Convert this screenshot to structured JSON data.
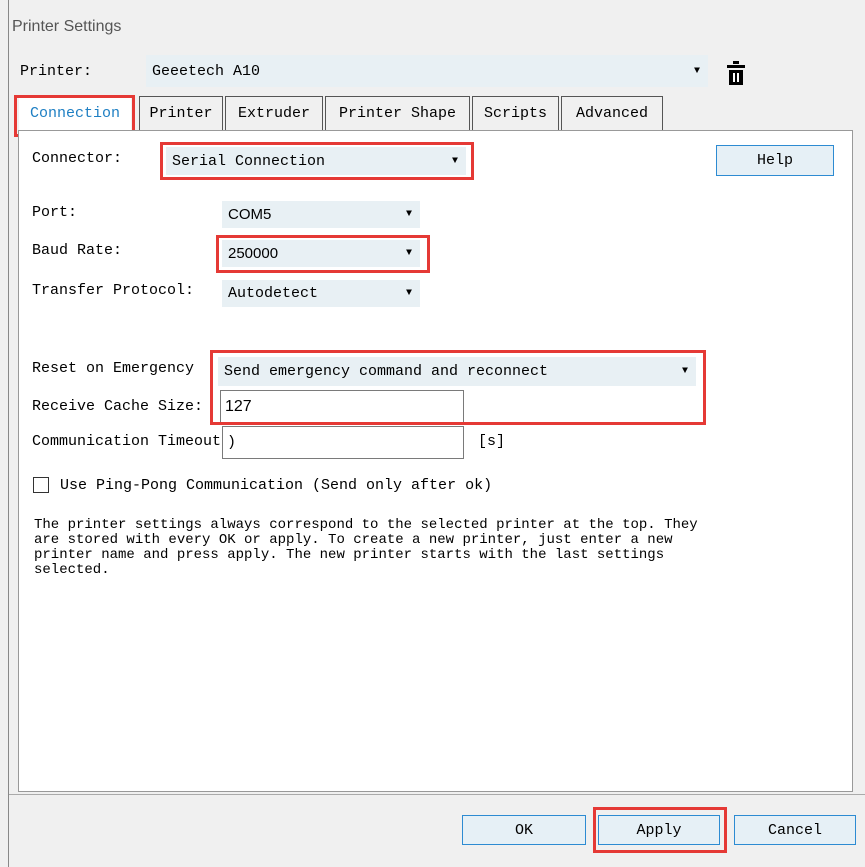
{
  "window": {
    "title": "Printer Settings"
  },
  "printer_row": {
    "label": "Printer:",
    "value": "Geeetech A10"
  },
  "tabs": [
    {
      "label": "Connection"
    },
    {
      "label": "Printer"
    },
    {
      "label": "Extruder"
    },
    {
      "label": "Printer Shape"
    },
    {
      "label": "Scripts"
    },
    {
      "label": "Advanced"
    }
  ],
  "connection": {
    "connector_label": "Connector:",
    "connector_value": "Serial Connection",
    "help_label": "Help",
    "port_label": "Port:",
    "port_value": "COM5",
    "baud_label": "Baud Rate:",
    "baud_value": "250000",
    "protocol_label": "Transfer Protocol:",
    "protocol_value": "Autodetect",
    "reset_label": "Reset on Emergency",
    "reset_value": "Send emergency command and reconnect",
    "cache_label": "Receive Cache Size:",
    "cache_value": "127",
    "timeout_label": "Communication Timeout:",
    "timeout_value": ")",
    "timeout_unit": "[s]",
    "pingpong_label": "Use Ping-Pong Communication (Send only after ok)",
    "info_text": "The printer settings always correspond to the selected printer at the top. They\nare stored with every OK or apply. To create a new printer, just enter a new\nprinter name and press apply. The new printer starts with the last settings\nselected."
  },
  "footer": {
    "ok_label": "OK",
    "apply_label": "Apply",
    "cancel_label": "Cancel"
  },
  "colors": {
    "highlight": "#e53935",
    "active_tab_text": "#1e7fc3",
    "combo_bg": "#e8f0f4",
    "button_border": "#2d8bd2"
  }
}
